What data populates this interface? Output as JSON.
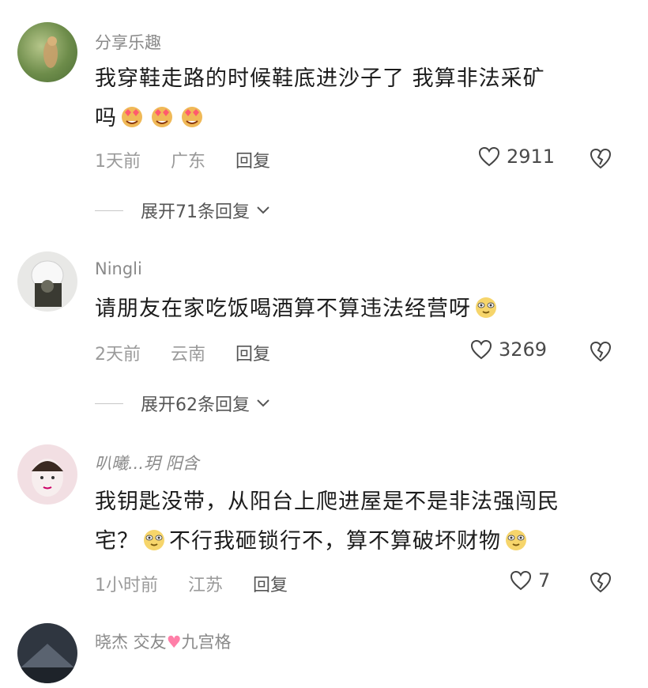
{
  "comments": [
    {
      "username": "分享乐趣",
      "text_line1": "我穿鞋走路的时候鞋底进沙子了 我算非法采矿",
      "text_line2": "吗",
      "emojis": [
        "heart-eyes-emoji",
        "heart-eyes-emoji",
        "heart-eyes-emoji"
      ],
      "time": "1天前",
      "location": "广东",
      "reply_label": "回复",
      "likes": "2911",
      "expand_label": "展开71条回复"
    },
    {
      "username": "Ningli",
      "text_line1": "请朋友在家吃饭喝酒算不算违法经营呀",
      "emojis": [
        "doge-emoji"
      ],
      "time": "2天前",
      "location": "云南",
      "reply_label": "回复",
      "likes": "3269",
      "expand_label": "展开62条回复"
    },
    {
      "username": "叭曦...玥 阳含",
      "text_line1": "我钥匙没带，从阳台上爬进屋是不是非法强闯民",
      "text_line2a": "宅？",
      "text_line2b": "不行我砸锁行不，算不算破坏财物",
      "emojis": [
        "doge-emoji",
        "doge-emoji"
      ],
      "time": "1小时前",
      "location": "江苏",
      "reply_label": "回复",
      "likes": "7"
    },
    {
      "username_a": "晓杰 交友",
      "username_b": "九宫格"
    }
  ],
  "colors": {
    "meta": "#9a9a9a",
    "text": "#1c1c1c",
    "emoji_face": "#f6d56b",
    "heart_eyes": "#ff5a6e"
  }
}
